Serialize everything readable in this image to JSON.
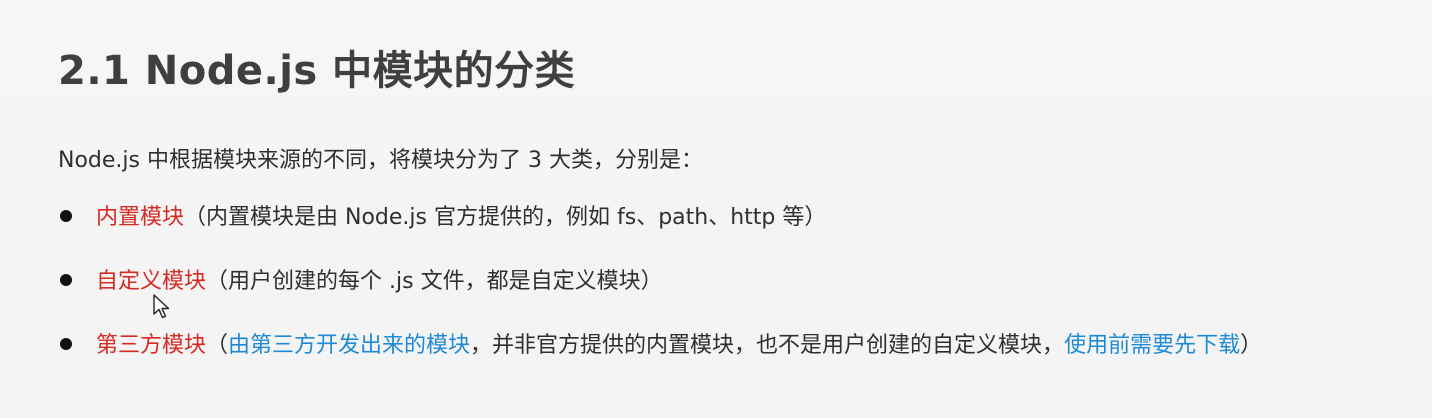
{
  "title": "2.1 Node.js 中模块的分类",
  "intro": "Node.js 中根据模块来源的不同，将模块分为了 3 大类，分别是：",
  "bullets": [
    {
      "name": "内置模块",
      "desc": "（内置模块是由 Node.js 官方提供的，例如 fs、path、http 等）"
    },
    {
      "name": "自定义模块",
      "desc": "（用户创建的每个 .js 文件，都是自定义模块）"
    },
    {
      "name": "第三方模块",
      "open": "（",
      "desc_blue_1": "由第三方开发出来的模块",
      "desc_mid": "，并非官方提供的内置模块，也不是用户创建的自定义模块，",
      "desc_blue_2": "使用前需要先下载",
      "close": "）"
    }
  ],
  "colors": {
    "highlight_red": "#d62a23",
    "highlight_blue": "#1e8ad6",
    "title": "#3f3f3f",
    "background": "#f5f5f5"
  },
  "icons": {
    "cursor": "mouse-pointer-icon",
    "bullet": "bullet-dot-icon"
  }
}
